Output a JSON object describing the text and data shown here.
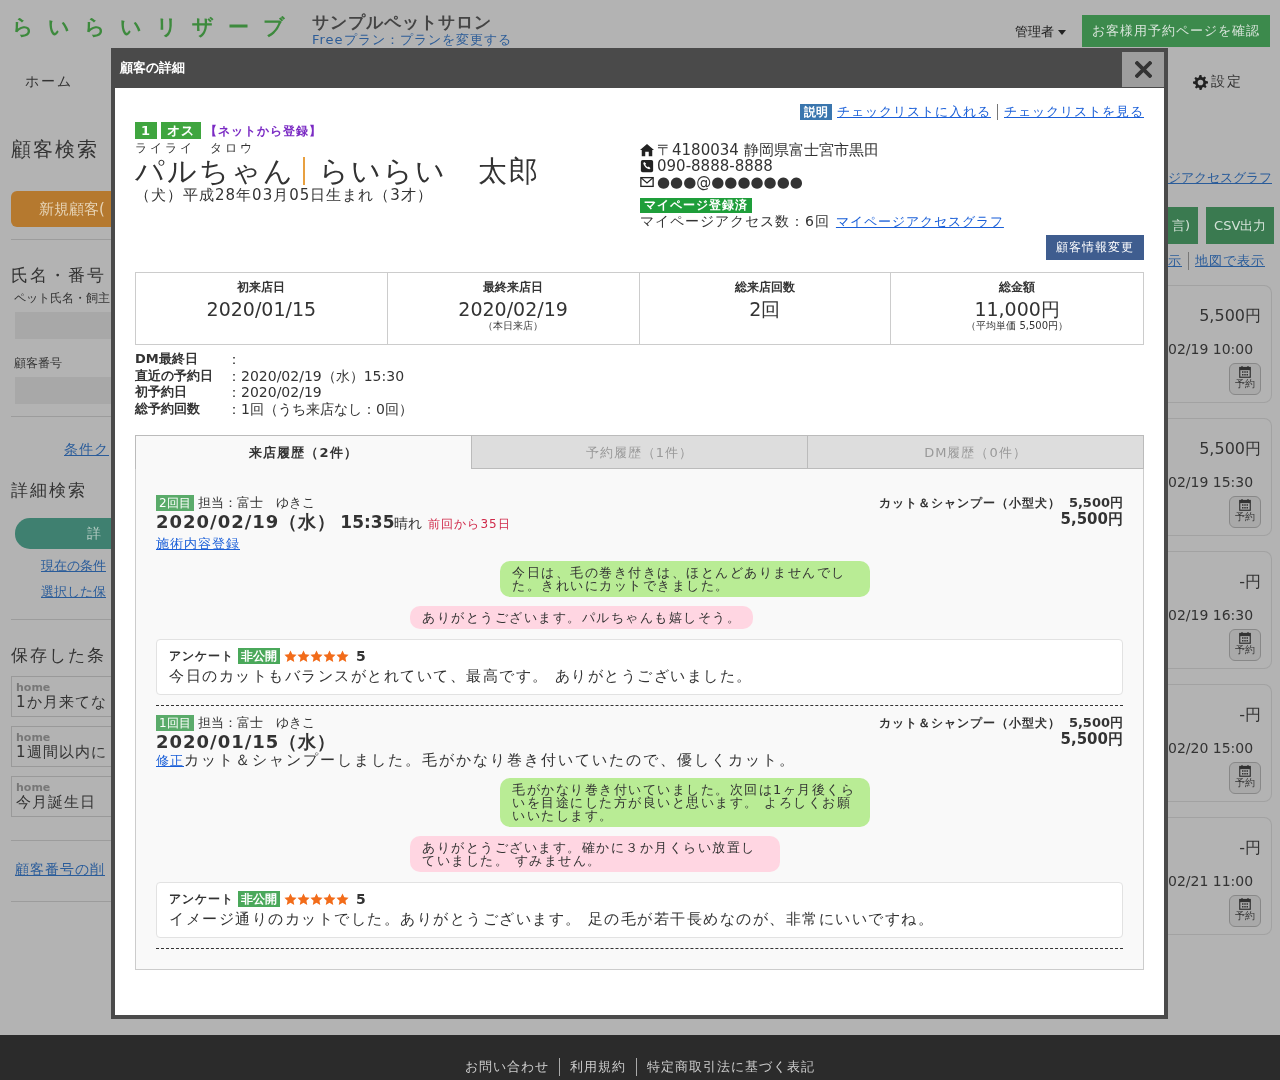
{
  "header": {
    "logo": "らいらいリザーブ",
    "shop_name": "サンプルペットサロン",
    "plan_link": "Freeプラン：プランを変更する",
    "user_menu": "管理者",
    "booking_page_button": "お客様用予約ページを確認"
  },
  "nav": {
    "home": "ホーム",
    "settings": "設定"
  },
  "sidebar": {
    "title": "顧客検索",
    "new_button": "新規顧客(",
    "name_section": "氏名・番号",
    "name_hint": "ペット氏名・飼主",
    "customer_no_label": "顧客番号",
    "clear_link": "条件ク",
    "detail_title": "詳細検索",
    "detail_button": "詳",
    "links": [
      "現在の条件",
      "選択した保"
    ],
    "saved_title": "保存した条",
    "saved": [
      {
        "tag": "home",
        "name": "1か月来てな"
      },
      {
        "tag": "home",
        "name": "1週間以内に"
      },
      {
        "tag": "home",
        "name": "今月誕生日"
      }
    ],
    "delete_link": "顧客番号の削"
  },
  "right_panel": {
    "graph_link": "ジアクセスグラフ",
    "buttons": [
      "言)",
      "CSV出力"
    ],
    "links": [
      "示",
      "地図で表示"
    ],
    "cards": [
      {
        "price": "5,500円",
        "datetime": "02/19 10:00",
        "button": "予約"
      },
      {
        "price": "5,500円",
        "datetime": "02/19 15:30",
        "button": "予約"
      },
      {
        "price": "-円",
        "datetime": "02/19 16:30",
        "button": "予約"
      },
      {
        "price": "-円",
        "datetime": "02/20 15:00",
        "button": "予約"
      },
      {
        "price": "-円",
        "datetime": "02/21 11:00",
        "button": "予約"
      }
    ]
  },
  "footer": {
    "links": [
      "お問い合わせ",
      "利用規約",
      "特定商取引法に基づく表記"
    ]
  },
  "modal": {
    "title": "顧客の詳細",
    "help_badge": "説明",
    "checklist_links": [
      "チェックリストに入れる",
      "チェックリストを見る"
    ],
    "customer": {
      "number": "1",
      "sex": "オス",
      "source": "【ネットから登録】",
      "kana": "ライライ　タロウ",
      "pet_name": "パルちゃん",
      "owner_name": "らいらい　太郎",
      "birth": "（犬）平成28年03月05日生まれ（3才）",
      "address": "〒4180034 静岡県富士宮市黒田",
      "phone": "090-8888-8888",
      "email": "●●●@●●●●●●●",
      "mypage_badge": "マイページ登録済",
      "mypage_access": "マイページアクセス数：6回",
      "mypage_graph_link": "マイページアクセスグラフ",
      "edit_button": "顧客情報変更"
    },
    "stats": [
      {
        "label": "初来店日",
        "value": "2020/01/15"
      },
      {
        "label": "最終来店日",
        "value": "2020/02/19",
        "note": "（本日来店）"
      },
      {
        "label": "総来店回数",
        "value": "2回"
      },
      {
        "label": "総金額",
        "value": "11,000円",
        "note": "（平均単価 5,500円）"
      }
    ],
    "details": [
      {
        "label": "DM最終日",
        "value": "："
      },
      {
        "label": "直近の予約日",
        "value": "：2020/02/19（水）15:30"
      },
      {
        "label": "初予約日",
        "value": "：2020/02/19"
      },
      {
        "label": "総予約回数",
        "value": "：1回（うち来店なし：0回）"
      }
    ],
    "tabs": [
      {
        "label": "来店履歴（2件）",
        "selected": true
      },
      {
        "label": "予約履歴（1件）",
        "selected": false
      },
      {
        "label": "DM履歴（0件）",
        "selected": false
      }
    ],
    "visits": [
      {
        "count_badge": "2回目",
        "staff": "担当：富士　ゆきこ",
        "date": "2020/02/19（水）",
        "time": "15:35",
        "weather": "晴れ",
        "since": "前回から35日",
        "link": "施術内容登録",
        "menu": "カット＆シャンプー（小型犬）",
        "menu_price": "5,500円",
        "total": "5,500円",
        "messages": [
          {
            "kind": "shop",
            "text": "今日は、毛の巻き付きは、ほとんどありませんでした。きれいにカットできました。"
          },
          {
            "kind": "customer",
            "text": "ありがとうございます。パルちゃんも嬉しそう。"
          }
        ],
        "survey": {
          "label": "アンケート",
          "visibility": "非公開",
          "stars": 5,
          "score": "5",
          "comment": "今日のカットもバランスがとれていて、最高です。 ありがとうございました。"
        }
      },
      {
        "count_badge": "1回目",
        "staff": "担当：富士　ゆきこ",
        "date": "2020/01/15（水）",
        "link": "修正",
        "note": "カット＆シャンプーしました。毛がかなり巻き付いていたので、優しくカット。",
        "menu": "カット＆シャンプー（小型犬）",
        "menu_price": "5,500円",
        "total": "5,500円",
        "messages": [
          {
            "kind": "shop",
            "text": "毛がかなり巻き付いていました。次回は1ヶ月後くらいを目途にした方が良いと思います。 よろしくお願いいたします。"
          },
          {
            "kind": "customer",
            "text": "ありがとうございます。確かに３か月くらい放置していました。 すみません。"
          }
        ],
        "survey": {
          "label": "アンケート",
          "visibility": "非公開",
          "stars": 5,
          "score": "5",
          "comment": "イメージ通りのカットでした。ありがとうございます。 足の毛が若干長めなのが、非常にいいですね。"
        }
      }
    ]
  }
}
